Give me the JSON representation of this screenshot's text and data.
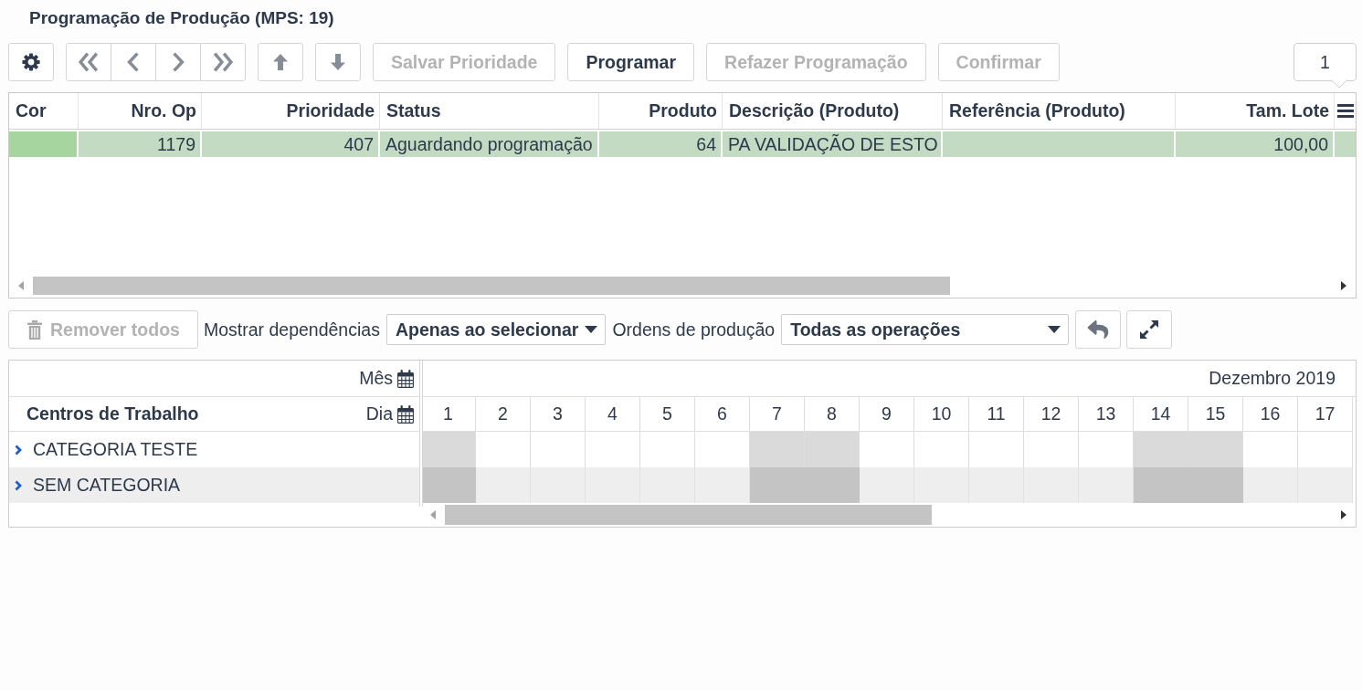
{
  "title": "Programação de Produção (MPS: 19)",
  "toolbar": {
    "items": [
      {
        "kind": "settings",
        "disabled": false
      },
      {
        "kind": "navigation",
        "buttons": [
          {
            "kind": "first",
            "disabled": true
          },
          {
            "kind": "previous",
            "disabled": true
          },
          {
            "kind": "next",
            "disabled": true
          },
          {
            "kind": "last",
            "disabled": true
          }
        ]
      },
      {
        "kind": "move_up",
        "disabled": true
      },
      {
        "kind": "move_down",
        "disabled": true
      },
      {
        "kind": "text",
        "label": "Salvar Prioridade",
        "disabled": true
      },
      {
        "kind": "text",
        "label": "Programar",
        "disabled": false
      },
      {
        "kind": "text",
        "label": "Refazer Programação",
        "disabled": true
      },
      {
        "kind": "text",
        "label": "Confirmar",
        "disabled": true
      }
    ],
    "count": "1"
  },
  "table": {
    "columns": [
      {
        "label": "Cor",
        "kind": "color"
      },
      {
        "label": "Nro. Op",
        "kind": "number"
      },
      {
        "label": "Prioridade",
        "kind": "number"
      },
      {
        "label": "Status",
        "kind": "text"
      },
      {
        "label": "Produto",
        "kind": "number"
      },
      {
        "label": "Descrição (Produto)",
        "kind": "text"
      },
      {
        "label": "Referência (Produto)",
        "kind": "text"
      },
      {
        "label": "Tam. Lote",
        "kind": "number"
      }
    ],
    "rows": [
      {
        "selected": true,
        "color": "#a6d5a0",
        "cells": [
          null,
          "1179",
          "407",
          "Aguardando programação",
          "64",
          "PA VALIDAÇÃO DE ESTO",
          null,
          "100,00"
        ]
      }
    ]
  },
  "gantt_toolbar": {
    "remove_all": {
      "label": "Remover todos",
      "disabled": true
    },
    "dependencies": {
      "label": "Mostrar dependências",
      "value": "Apenas ao selecionar"
    },
    "orders": {
      "label": "Ordens de produção",
      "value": "Todas as operações"
    },
    "undo": {
      "disabled": true
    },
    "fullscreen": {
      "disabled": false
    }
  },
  "gantt": {
    "month_scale": "Mês",
    "day_scale": "Dia",
    "resources_title": "Centros de Trabalho",
    "month": "Dezembro 2019",
    "days": [
      {
        "label": "1",
        "weekend": true
      },
      {
        "label": "2",
        "weekend": false
      },
      {
        "label": "3",
        "weekend": false
      },
      {
        "label": "4",
        "weekend": false
      },
      {
        "label": "5",
        "weekend": false
      },
      {
        "label": "6",
        "weekend": false
      },
      {
        "label": "7",
        "weekend": true
      },
      {
        "label": "8",
        "weekend": true
      },
      {
        "label": "9",
        "weekend": false
      },
      {
        "label": "10",
        "weekend": false
      },
      {
        "label": "11",
        "weekend": false
      },
      {
        "label": "12",
        "weekend": false
      },
      {
        "label": "13",
        "weekend": false
      },
      {
        "label": "14",
        "weekend": true
      },
      {
        "label": "15",
        "weekend": true
      },
      {
        "label": "16",
        "weekend": false
      },
      {
        "label": "17",
        "weekend": false
      }
    ],
    "rows": [
      {
        "label": "CATEGORIA TESTE",
        "expanded": false
      },
      {
        "label": "SEM CATEGORIA",
        "expanded": false
      }
    ]
  }
}
